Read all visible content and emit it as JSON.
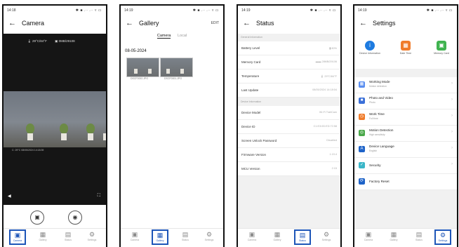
{
  "status_bar": {
    "time_1": "14:18",
    "time_2": "14:19",
    "time_3": "14:19",
    "time_4": "14:19",
    "icons": "✱ ■ .∙∙ .∙∙ ▿ ▭"
  },
  "nav": {
    "camera": "Camera",
    "gallery": "Gallery",
    "status": "Status",
    "settings": "Settings"
  },
  "camera": {
    "title": "Camera",
    "temp": "29°C/84°F",
    "storage": "0MB/29108",
    "timestamp": "C:  29°C  08/05/2024  14:18:39"
  },
  "gallery": {
    "title": "Gallery",
    "edit": "EDIT",
    "tab_camera": "Camera",
    "tab_local": "Local",
    "date": "08-05-2024",
    "files": [
      "DSCF0002.JPG",
      "DSCF0001.JPG"
    ]
  },
  "status": {
    "title": "Status",
    "section_general": "General Information",
    "section_device": "Device Information",
    "general_rows": [
      {
        "label": "Battery Level",
        "value": "80%"
      },
      {
        "label": "Memory Card",
        "value": "28MB/29106"
      },
      {
        "label": "Temperature",
        "value": "29°C/84°F"
      },
      {
        "label": "Last Update",
        "value": "08/05/2024 14:18:04"
      }
    ],
    "device_rows": [
      {
        "label": "Device Model",
        "value": "Wi-Fi TrailCam"
      },
      {
        "label": "Device ID",
        "value": "C1:E3:0D:ED:72:58"
      },
      {
        "label": "Screen Unlock Password",
        "value": "Disabled"
      },
      {
        "label": "Firmware Version",
        "value": "1.19.4"
      },
      {
        "label": "MCU Version",
        "value": "2.15"
      }
    ]
  },
  "settings": {
    "title": "Settings",
    "quick": [
      {
        "label": "Device Information",
        "color": "#1e7be0"
      },
      {
        "label": "Date Time",
        "color": "#f07b2a"
      },
      {
        "label": "Memory Card",
        "color": "#3fb34f"
      }
    ],
    "rows": [
      {
        "title": "Working Mode",
        "sub": "Motion detection",
        "color": "#5a8ef0"
      },
      {
        "title": "Photo and Video",
        "sub": "Photo",
        "color": "#3a6fd8"
      },
      {
        "title": "Work Time",
        "sub": "Full time",
        "color": "#f07b2a"
      },
      {
        "title": "Motion Detection",
        "sub": "High sensitivity",
        "color": "#4aa84a"
      },
      {
        "title": "Device Language",
        "sub": "English",
        "color": "#1e63c8"
      },
      {
        "title": "Security",
        "sub": "",
        "color": "#3bb6c8"
      },
      {
        "title": "Factory Reset",
        "sub": "",
        "color": "#1e63c8"
      }
    ]
  },
  "colors": {
    "accent": "#1d55b8"
  }
}
